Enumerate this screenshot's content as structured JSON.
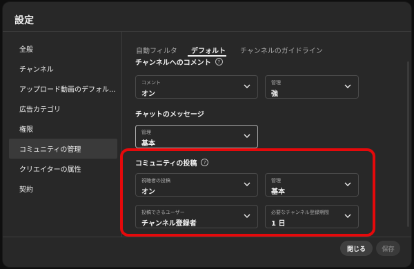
{
  "dialog": {
    "title": "設定",
    "close_label": "閉じる",
    "save_label": "保存"
  },
  "sidebar": {
    "items": [
      {
        "label": "全般"
      },
      {
        "label": "チャンネル"
      },
      {
        "label": "アップロード動画のデフォル..."
      },
      {
        "label": "広告カテゴリ"
      },
      {
        "label": "権限"
      },
      {
        "label": "コミュニティの管理",
        "active": true
      },
      {
        "label": "クリエイターの属性"
      },
      {
        "label": "契約"
      }
    ]
  },
  "tabs": [
    {
      "label": "自動フィルタ"
    },
    {
      "label": "デフォルト",
      "active": true
    },
    {
      "label": "チャンネルのガイドライン"
    }
  ],
  "sections": {
    "channel_comments": {
      "title": "チャンネルへのコメント",
      "comment": {
        "label": "コメント",
        "value": "オン"
      },
      "moderation": {
        "label": "管理",
        "value": "強"
      }
    },
    "chat": {
      "title": "チャットのメッセージ",
      "moderation": {
        "label": "管理",
        "value": "基本"
      }
    },
    "community": {
      "title": "コミュニティの投稿",
      "viewer_posts": {
        "label": "視聴者の投稿",
        "value": "オン"
      },
      "moderation": {
        "label": "管理",
        "value": "基本"
      },
      "who_can_post": {
        "label": "投稿できるユーザー",
        "value": "チャンネル登録者"
      },
      "required_period": {
        "label": "必要なチャンネル登録期間",
        "value": "1 日"
      }
    }
  },
  "colors": {
    "highlight_box": "#e5090b",
    "dialog_bg": "#282828"
  }
}
